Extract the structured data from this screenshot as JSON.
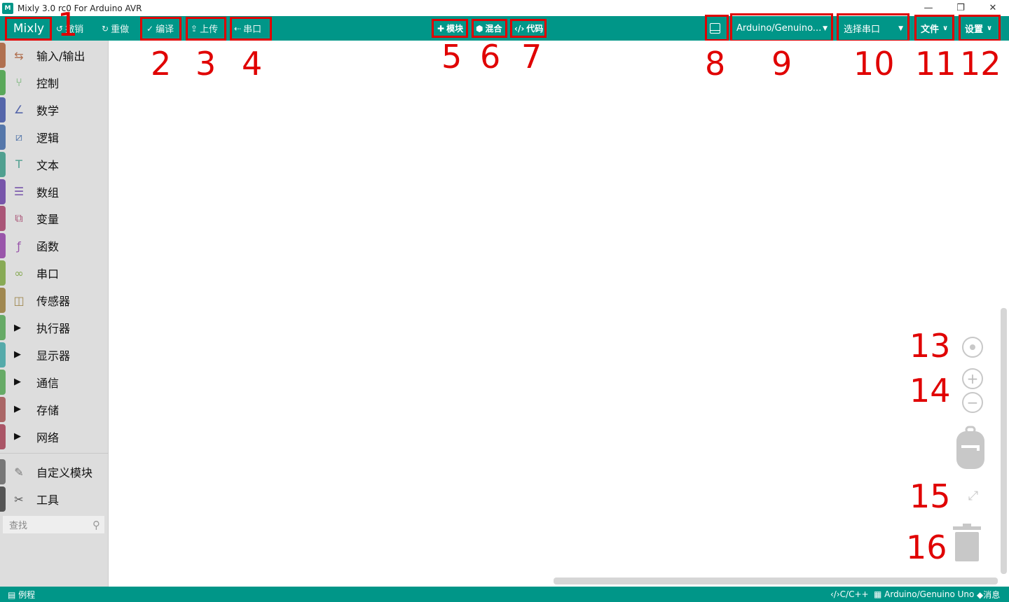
{
  "window": {
    "title": "Mixly 3.0 rc0 For Arduino AVR",
    "icon_text": "M"
  },
  "toolbar": {
    "logo": "Mixly",
    "undo": "撤销",
    "redo": "重做",
    "compile": "编译",
    "upload": "上传",
    "serial": "串口",
    "blocks": "模块",
    "mixed": "混合",
    "code": "代码",
    "board": "Arduino/Genuino...",
    "port": "选择串口",
    "file": "文件",
    "settings": "设置"
  },
  "annotations": [
    "1",
    "2",
    "3",
    "4",
    "5",
    "6",
    "7",
    "8",
    "9",
    "10",
    "11",
    "12",
    "13",
    "14",
    "15",
    "16"
  ],
  "sidebar": {
    "categories": [
      {
        "label": "输入/输出",
        "icon": "io-icon",
        "glyph": "⇆",
        "color": "#b07050",
        "expandable": false
      },
      {
        "label": "控制",
        "icon": "control-icon",
        "glyph": "⑂",
        "color": "#5aa85a",
        "expandable": false
      },
      {
        "label": "数学",
        "icon": "math-icon",
        "glyph": "∠",
        "color": "#5566aa",
        "expandable": false
      },
      {
        "label": "逻辑",
        "icon": "logic-icon",
        "glyph": "⧄",
        "color": "#5577aa",
        "expandable": false
      },
      {
        "label": "文本",
        "icon": "text-icon",
        "glyph": "T",
        "color": "#50a090",
        "expandable": false
      },
      {
        "label": "数组",
        "icon": "array-icon",
        "glyph": "☰",
        "color": "#7755aa",
        "expandable": false
      },
      {
        "label": "变量",
        "icon": "variable-icon",
        "glyph": "⧉",
        "color": "#aa5577",
        "expandable": false
      },
      {
        "label": "函数",
        "icon": "function-icon",
        "glyph": "ƒ",
        "color": "#9955aa",
        "expandable": false
      },
      {
        "label": "串口",
        "icon": "serial-icon",
        "glyph": "∞",
        "color": "#88aa55",
        "expandable": false
      },
      {
        "label": "传感器",
        "icon": "sensor-icon",
        "glyph": "◫",
        "color": "#a08850",
        "expandable": false
      },
      {
        "label": "执行器",
        "icon": "actuator-icon",
        "glyph": "",
        "color": "#66aa66",
        "expandable": true
      },
      {
        "label": "显示器",
        "icon": "display-icon",
        "glyph": "",
        "color": "#55aaaa",
        "expandable": true
      },
      {
        "label": "通信",
        "icon": "comm-icon",
        "glyph": "",
        "color": "#66aa66",
        "expandable": true
      },
      {
        "label": "存储",
        "icon": "storage-icon",
        "glyph": "",
        "color": "#aa6666",
        "expandable": true
      },
      {
        "label": "网络",
        "icon": "network-icon",
        "glyph": "",
        "color": "#aa5566",
        "expandable": true
      }
    ],
    "extra": [
      {
        "label": "自定义模块",
        "icon": "custom-block-icon",
        "glyph": "✎",
        "color": "#777777"
      },
      {
        "label": "工具",
        "icon": "tools-icon",
        "glyph": "✂",
        "color": "#555555"
      }
    ],
    "search_placeholder": "查找"
  },
  "statusbar": {
    "examples": "例程",
    "language": "C/C++",
    "board": "Arduino/Genuino Uno",
    "messages": "消息"
  },
  "colors": {
    "accent": "#009688",
    "annotation": "#e00000"
  }
}
